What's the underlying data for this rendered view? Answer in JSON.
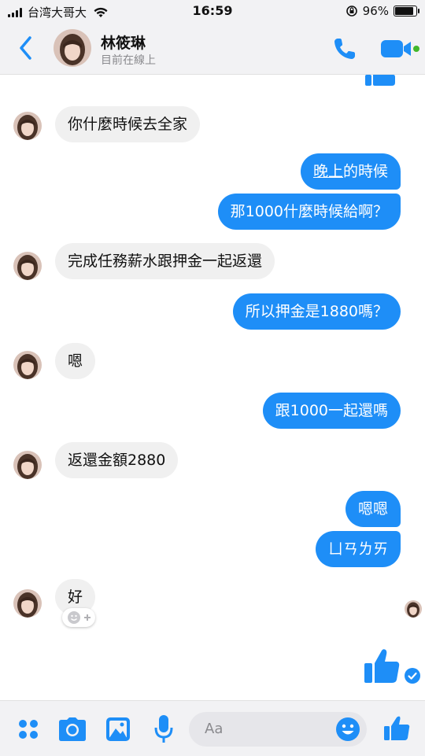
{
  "status_bar": {
    "carrier": "台湾大哥大",
    "time": "16:59",
    "battery": "96%",
    "battery_level": 0.96
  },
  "header": {
    "name": "林筱琳",
    "status": "目前在線上"
  },
  "messages": [
    {
      "dir": "in",
      "text": "你什麼時候去全家"
    },
    {
      "dir": "out",
      "text_link": "晚上",
      "text_rest": "的時候"
    },
    {
      "dir": "out",
      "text": "那1000什麼時候給啊？"
    },
    {
      "dir": "in",
      "text": "完成任務薪水跟押金一起返還"
    },
    {
      "dir": "out",
      "text": "所以押金是1880嗎？"
    },
    {
      "dir": "in",
      "text": "嗯"
    },
    {
      "dir": "out",
      "text": "跟1000一起還嗎"
    },
    {
      "dir": "in",
      "text": "返還金額2880"
    },
    {
      "dir": "out",
      "text": "嗯嗯"
    },
    {
      "dir": "out",
      "text": "ㄩㄢㄌㄞ"
    },
    {
      "dir": "in",
      "text": "好"
    }
  ],
  "composer": {
    "placeholder": "Aa"
  },
  "colors": {
    "accent": "#1e8ef7",
    "incoming_bubble": "#f0f0f0",
    "bar_bg": "#f2f2f4"
  },
  "icons": [
    "back-arrow-icon",
    "phone-icon",
    "video-icon",
    "apps-icon",
    "camera-icon",
    "gallery-icon",
    "microphone-icon",
    "emoji-icon",
    "thumbs-up-icon",
    "sent-check-icon",
    "add-reaction-icon"
  ]
}
